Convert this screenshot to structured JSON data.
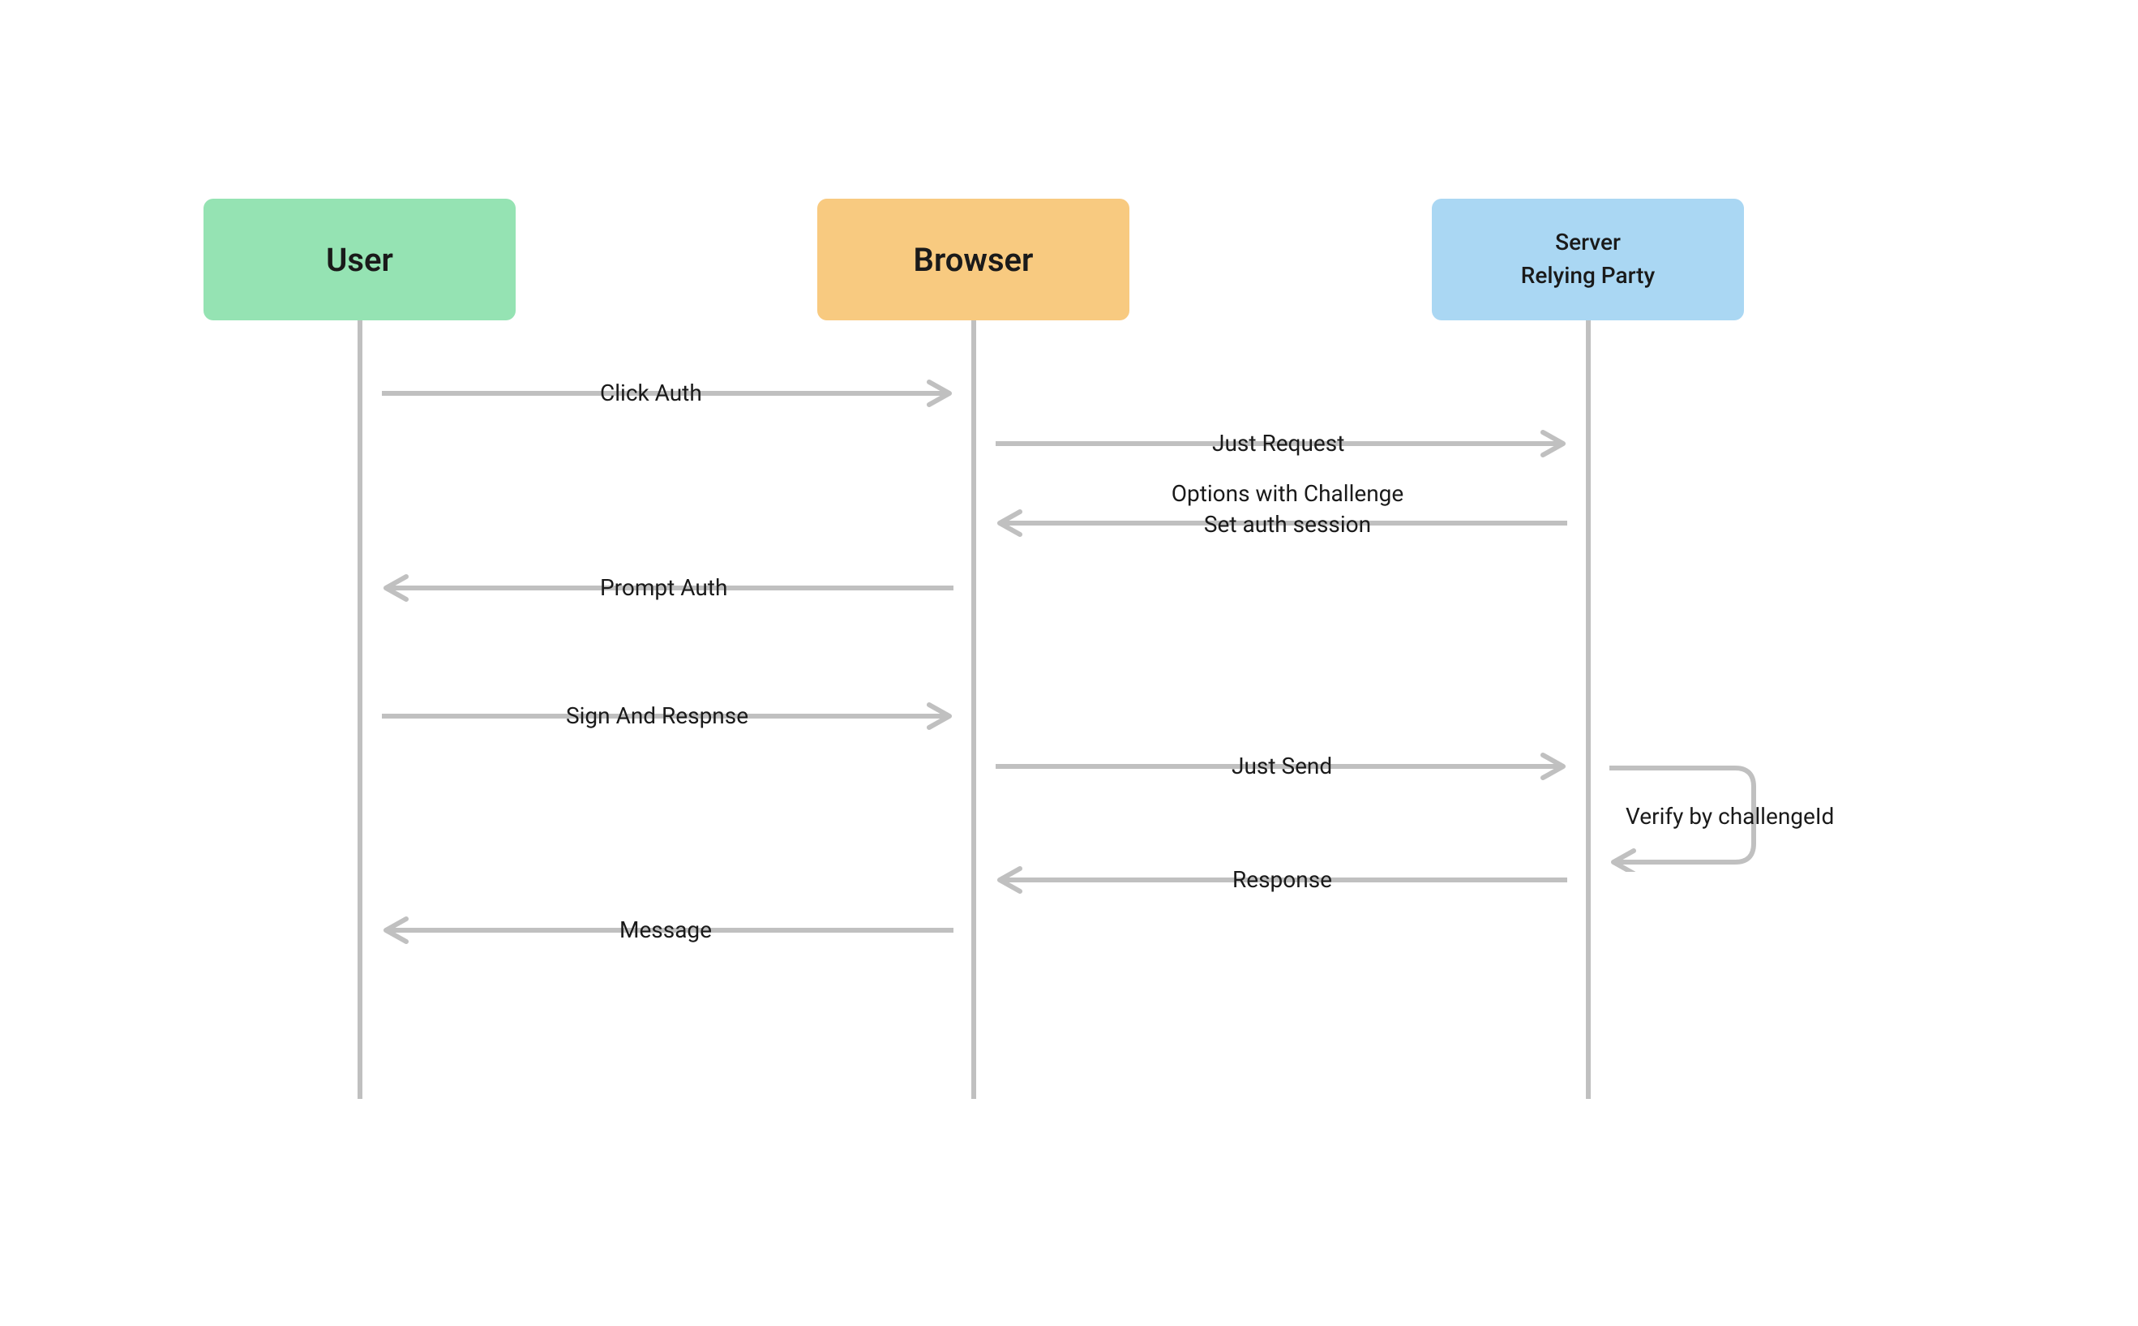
{
  "actors": {
    "user": {
      "label": "User"
    },
    "browser": {
      "label": "Browser"
    },
    "server": {
      "line1": "Server",
      "line2": "Relying Party"
    }
  },
  "messages": {
    "click_auth": "Click Auth",
    "just_request": "Just Request",
    "options_challenge": "Options with Challenge\nSet auth session",
    "prompt_auth": "Prompt Auth",
    "sign_response": "Sign And Respnse",
    "just_send": "Just Send",
    "verify": "Verify by challengeId",
    "response": "Response",
    "message": "Message"
  },
  "colors": {
    "user_bg": "#95e3b3",
    "browser_bg": "#f8ca80",
    "server_bg": "#aad7f3",
    "line": "#c0c0c0",
    "text": "#1a1a1a"
  }
}
